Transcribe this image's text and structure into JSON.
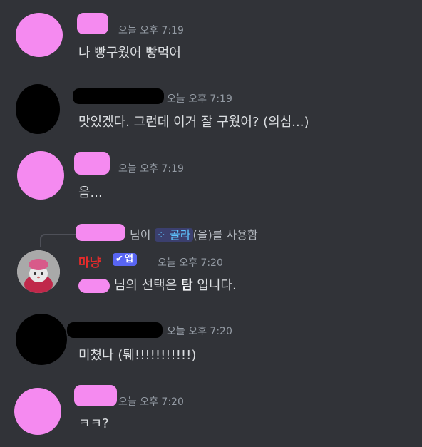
{
  "colors": {
    "background": "#313338",
    "text": "#dbdee1",
    "muted": "#949ba4",
    "bot_name": "#e52b2b",
    "app_badge": "#5865f2",
    "command": "#5ec4ff"
  },
  "messages": [
    {
      "timestamp": "오늘 오후 7:19",
      "text": "나 빵구웠어 빵먹어"
    },
    {
      "timestamp": "오늘 오후 7:19",
      "text": "맛있겠다. 그런데 이거 잘 구웠어? (의심...)"
    },
    {
      "timestamp": "오늘 오후 7:19",
      "text": "음..."
    },
    {
      "reply": {
        "suffix": "님이",
        "command_icon": "⁘",
        "command": "골라",
        "after": "(을)를 사용함"
      },
      "bot_name": "마냥",
      "badge": "앱",
      "timestamp": "오늘 오후 7:20",
      "text_before": "님의 선택은",
      "text_bold": "탐",
      "text_after": "입니다."
    },
    {
      "timestamp": "오늘 오후 7:20",
      "text": "미쳤나 (퉤!!!!!!!!!!!)"
    },
    {
      "timestamp": "오늘 오후 7:20",
      "text": "ㅋㅋ?"
    }
  ]
}
